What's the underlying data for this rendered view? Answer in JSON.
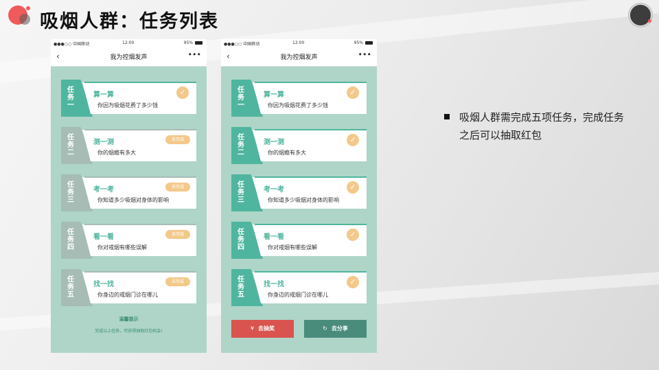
{
  "slide": {
    "title": "吸烟人群：任务列表",
    "bullet": "吸烟人群需完成五项任务，完成任务之后可以抽取红包"
  },
  "phone": {
    "status": {
      "carrier": "●●●○○ 中国移动",
      "time": "12:00",
      "battery": "95%"
    },
    "nav": {
      "back_icon": "‹",
      "title": "我为控烟发声",
      "more_icon": "•••"
    }
  },
  "left_screen": {
    "tasks": [
      {
        "tag": "任务一",
        "title": "算一算",
        "desc": "你因为吸烟花费了多少钱",
        "status": "done"
      },
      {
        "tag": "任务二",
        "title": "测一测",
        "desc": "你的烟瘾有多大",
        "status": "todo",
        "button": "去完成"
      },
      {
        "tag": "任务三",
        "title": "考一考",
        "desc": "你知道多少吸烟对身体的影响",
        "status": "todo",
        "button": "去完成"
      },
      {
        "tag": "任务四",
        "title": "看一看",
        "desc": "你对戒烟有哪些误解",
        "status": "todo",
        "button": "去完成"
      },
      {
        "tag": "任务五",
        "title": "找一找",
        "desc": "你身边的戒烟门诊在哪儿",
        "status": "todo",
        "button": "去完成"
      }
    ],
    "tip_title": "温馨提示",
    "tip_text": "完成以上任务，可获得抽取红包机会!"
  },
  "right_screen": {
    "tasks": [
      {
        "tag": "任务一",
        "title": "算一算",
        "desc": "你因为吸烟花费了多少钱",
        "status": "done"
      },
      {
        "tag": "任务二",
        "title": "测一测",
        "desc": "你的烟瘾有多大",
        "status": "done"
      },
      {
        "tag": "任务三",
        "title": "考一考",
        "desc": "你知道多少吸烟对身体的影响",
        "status": "done"
      },
      {
        "tag": "任务四",
        "title": "看一看",
        "desc": "你对戒烟有哪些误解",
        "status": "done"
      },
      {
        "tag": "任务五",
        "title": "找一找",
        "desc": "你身边的戒烟门诊在哪儿",
        "status": "done"
      }
    ],
    "lottery_button": "去抽奖",
    "share_button": "去分享"
  },
  "icons": {
    "check": "✓",
    "lottery": "¥",
    "share": "↻"
  },
  "colors": {
    "accent": "#4fb59e",
    "inactive": "#a6bcb5",
    "badge": "#f3c98a",
    "lottery": "#d9534f",
    "share": "#4a8c7c",
    "screen_bg": "#aed5c7"
  }
}
